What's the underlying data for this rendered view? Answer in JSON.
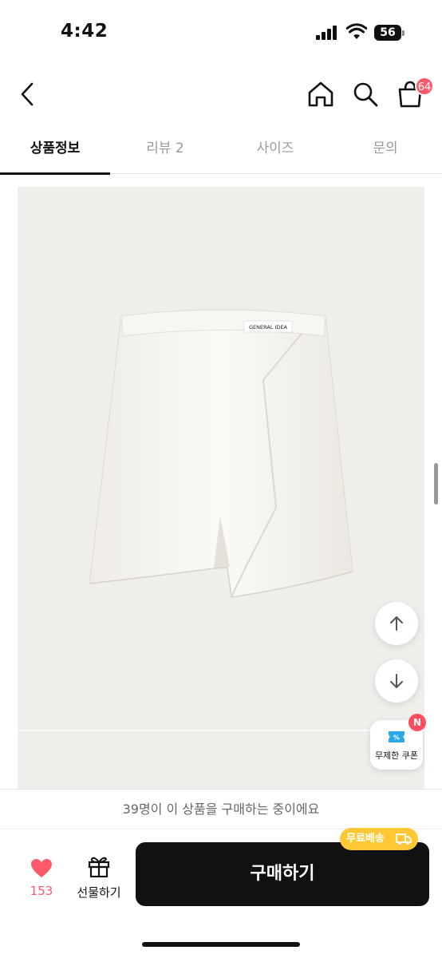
{
  "status_bar": {
    "time": "4:42",
    "battery": "56"
  },
  "header": {
    "cart_count": "64"
  },
  "tabs": [
    {
      "label": "상품정보"
    },
    {
      "label": "리뷰 2"
    },
    {
      "label": "사이즈"
    },
    {
      "label": "문의"
    }
  ],
  "product": {
    "tag_text": "GENERAL IDEA"
  },
  "floating": {
    "coupon_label": "무제한 쿠폰",
    "coupon_badge": "N"
  },
  "bottom": {
    "notice": "39명이 이 상품을 구매하는 중이에요",
    "like_count": "153",
    "gift_label": "선물하기",
    "buy_label": "구매하기",
    "free_shipping": "무료배송"
  },
  "colors": {
    "accent": "#ff5a6b",
    "badge_yellow": "#ffc733",
    "buy_button": "#111111"
  }
}
